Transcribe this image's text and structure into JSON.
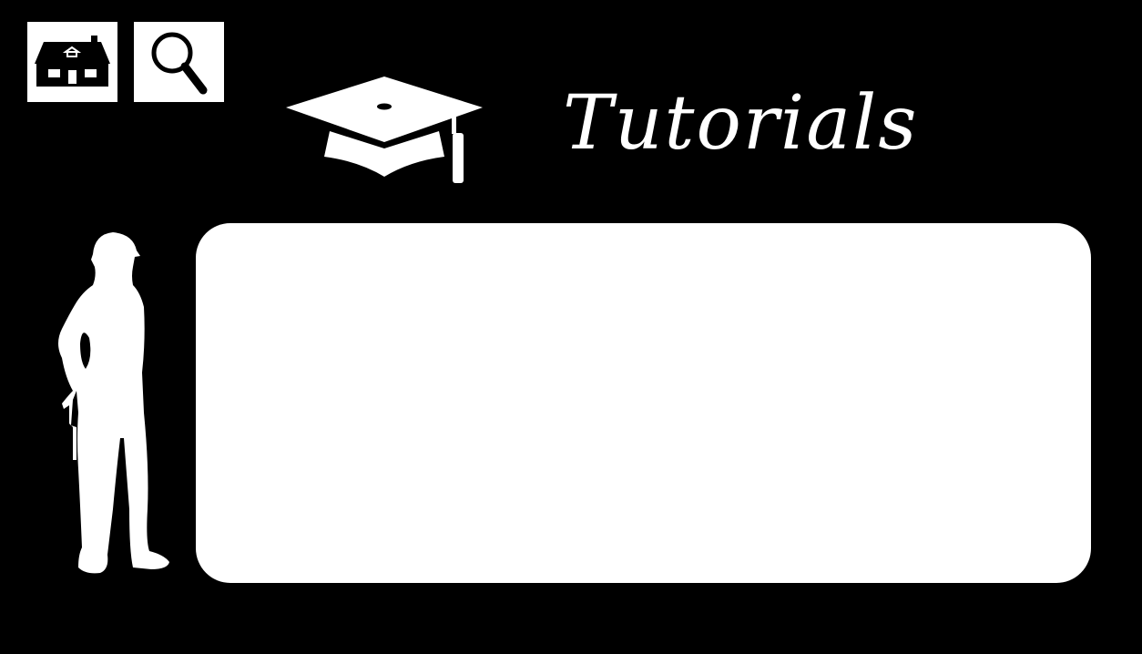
{
  "header": {
    "title": "Tutorials"
  },
  "nav": {
    "home_icon": "house-icon",
    "search_icon": "magnifier-icon"
  },
  "decor": {
    "cap_icon": "graduation-cap-icon",
    "figure_icon": "construction-worker-silhouette"
  },
  "colors": {
    "background": "#000000",
    "foreground": "#ffffff"
  }
}
